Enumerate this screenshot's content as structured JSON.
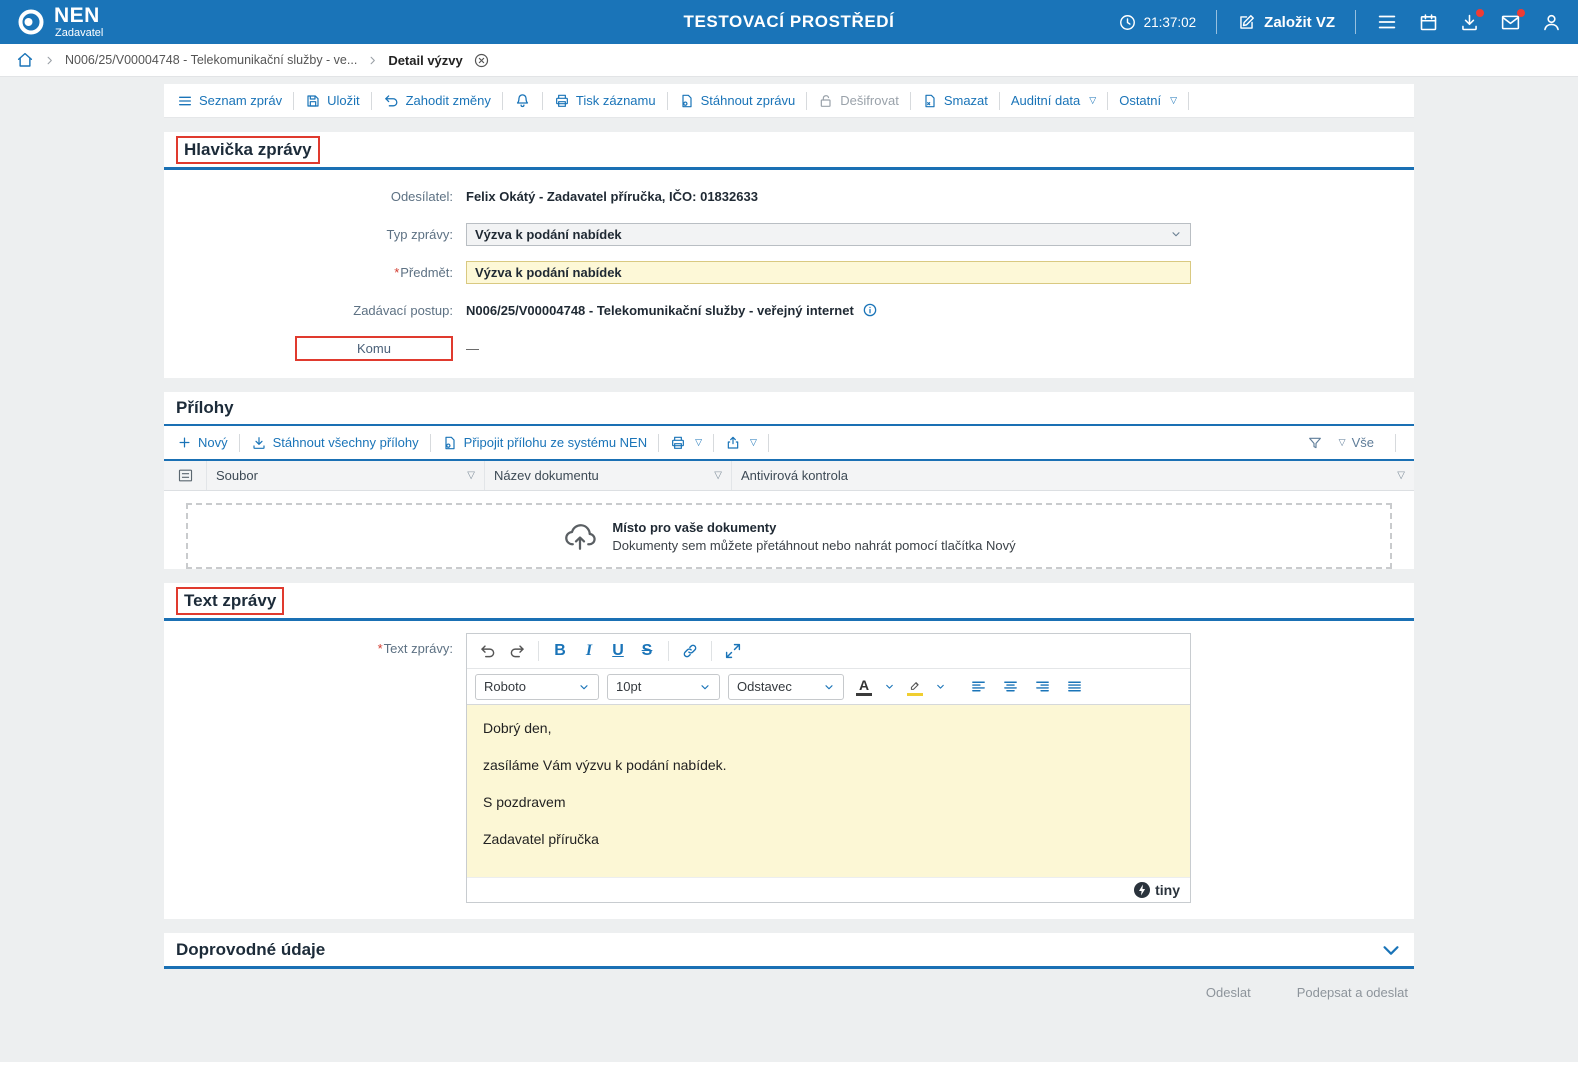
{
  "icons": {
    "chevron_down_small": "▽"
  },
  "header": {
    "brand": "NEN",
    "brand_subtitle": "Zadavatel",
    "environment_title": "TESTOVACÍ PROSTŘEDÍ",
    "clock_time": "21:37:02",
    "create_vz_label": "Založit VZ"
  },
  "breadcrumb": {
    "procedure": "N006/25/V00004748 - Telekomunikační služby - ve...",
    "current": "Detail výzvy"
  },
  "command_bar": {
    "seznam_zprav": "Seznam zpráv",
    "ulozit": "Uložit",
    "zahodit_zmeny": "Zahodit změny",
    "tisk_zaznamu": "Tisk záznamu",
    "stahnout_zpravu": "Stáhnout zprávu",
    "desifrovat": "Dešifrovat",
    "smazat": "Smazat",
    "auditni_data": "Auditní data",
    "ostatni": "Ostatní"
  },
  "message_header": {
    "section_title": "Hlavička zprávy",
    "required_mark": "*",
    "sender_label": "Odesílatel:",
    "sender_value": "Felix Okátý - Zadavatel příručka, IČO: 01832633",
    "message_type_label": "Typ zprávy:",
    "message_type_value": "Výzva k podání nabídek",
    "subject_label": "Předmět:",
    "subject_value": "Výzva k podání nabídek",
    "procedure_label": "Zadávací postup:",
    "procedure_value": "N006/25/V00004748 - Telekomunikační služby - veřejný internet",
    "recipient_label": "Komu",
    "recipient_value": "—"
  },
  "attachments": {
    "section_title": "Přílohy",
    "new_label": "Nový",
    "download_all_label": "Stáhnout všechny přílohy",
    "attach_from_nen_label": "Připojit přílohu ze systému NEN",
    "filter_all_label": "Vše",
    "columns": [
      "Soubor",
      "Název dokumentu",
      "Antivirová kontrola"
    ],
    "dropzone_title": "Místo pro vaše dokumenty",
    "dropzone_subtitle": "Dokumenty sem můžete přetáhnout nebo nahrát pomocí tlačítka Nový"
  },
  "message_body": {
    "section_title": "Text zprávy",
    "field_label": "Text zprávy:",
    "editor": {
      "font_family": "Roboto",
      "font_size": "10pt",
      "block_format": "Odstavec",
      "bold": "B",
      "italic": "I",
      "underline": "U",
      "strikethrough": "S",
      "forecolor": "A",
      "paragraphs": [
        "Dobrý den,",
        "zasíláme Vám výzvu k podání nabídek.",
        "S pozdravem",
        "Zadavatel příručka"
      ],
      "brand": "tiny"
    }
  },
  "additional_info": {
    "section_title": "Doprovodné údaje"
  },
  "footer": {
    "send_label": "Odeslat",
    "sign_and_send_label": "Podepsat a odeslat"
  },
  "colors": {
    "primary_blue": "#1a74b8",
    "annotation_red": "#e03a2e",
    "input_yellow": "#fdf8d7"
  }
}
